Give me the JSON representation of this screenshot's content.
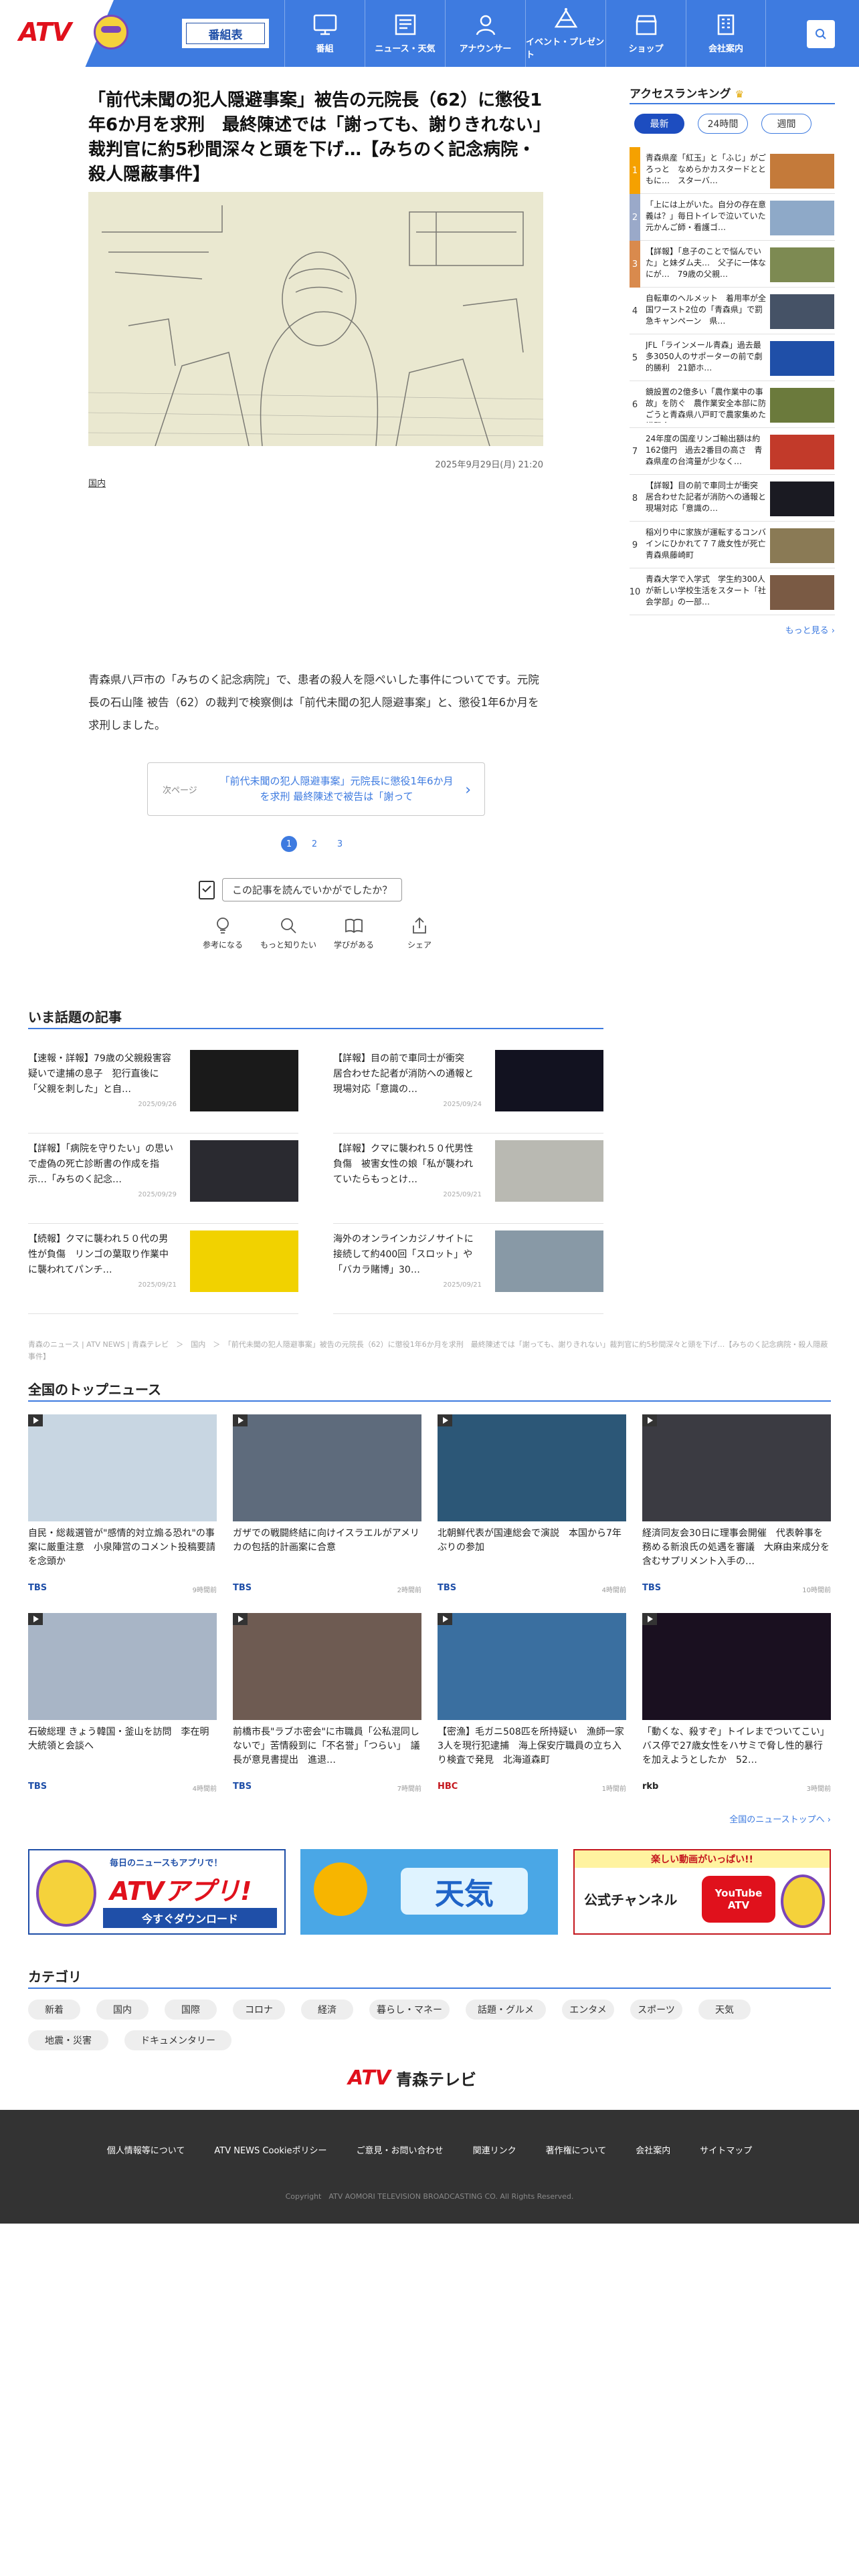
{
  "header": {
    "logo": "ATV",
    "program_button": "番組表",
    "nav": [
      {
        "label": "番組",
        "icon": "tv-icon"
      },
      {
        "label": "ニュース・天気",
        "icon": "news-icon"
      },
      {
        "label": "アナウンサー",
        "icon": "announcer-icon"
      },
      {
        "label": "イベント・プレゼント",
        "icon": "event-icon"
      },
      {
        "label": "ショップ",
        "icon": "shop-icon"
      },
      {
        "label": "会社案内",
        "icon": "company-icon"
      }
    ],
    "search_icon": "search-icon"
  },
  "article": {
    "title": "「前代未聞の犯人隠避事案」被告の元院長（62）に懲役1年6か月を求刑　最終陳述では「謝っても、謝りきれない」裁判官に約5秒間深々と頭を下げ…【みちのく記念病院・殺人隠蔽事件】",
    "date": "2025年9月29日(月) 21:20",
    "category": "国内",
    "body": "青森県八戸市の「みちのく記念病院」で、患者の殺人を隠ぺいした事件についてです。元院長の石山隆 被告（62）の裁判で検察側は「前代未聞の犯人隠避事案」と、懲役1年6か月を求刑しました。",
    "next_label": "次ページ",
    "next_title": "「前代未聞の犯人隠避事案」元院長に懲役1年6か月を求刑 最終陳述で被告は「謝って",
    "pages": [
      "1",
      "2",
      "3"
    ],
    "feedback_question": "この記事を読んでいかがでしたか？",
    "reactions": [
      "参考になる",
      "もっと知りたい",
      "学びがある",
      "シェア"
    ]
  },
  "ranking": {
    "title": "アクセスランキング",
    "tabs": [
      "最新",
      "24時間",
      "週間"
    ],
    "items": [
      {
        "rank": "1",
        "text": "青森県産「紅玉」と「ふじ」がごろっと　なめらかカスタードとともに…　スターバ…",
        "thumb": "#c47a3a"
      },
      {
        "rank": "2",
        "text": "「上には上がいた。自分の存在意義は？」毎日トイレで泣いていた元かんご師・看護ゴ…",
        "thumb": "#8ea9c8"
      },
      {
        "rank": "3",
        "text": "【詳報】「息子のことで悩んでいた」と妹ダム夫…　父子に一体なにが…　79歳の父親…",
        "thumb": "#7d8a52"
      },
      {
        "rank": "4",
        "text": "自転車のヘルメット　着用率が全国ワースト2位の「青森県」で罰急キャンペーン　県…",
        "thumb": "#455266"
      },
      {
        "rank": "5",
        "text": "JFL「ラインメール青森」過去最多3050人のサポーターの前で劇的勝利　21節ホ…",
        "thumb": "#1f4fa8"
      },
      {
        "rank": "6",
        "text": "鏡設置の2億多い「農作業中の事故」を防ぐ　農作業安全本部に防ごうと青森県八戸町で農家集めた講習会…",
        "thumb": "#6b7a3c"
      },
      {
        "rank": "7",
        "text": "24年度の国産リンゴ輸出額は約162億円　過去2番目の高さ　青森県産の台湾量が少なく…",
        "thumb": "#c23a2a"
      },
      {
        "rank": "8",
        "text": "【詳報】目の前で車同士が衝突　居合わせた記者が消防への通報と現場対応「意識の…",
        "thumb": "#1a1a22"
      },
      {
        "rank": "9",
        "text": "稲刈り中に家族が運転するコンバインにひかれて７７歳女性が死亡　青森県藤崎町",
        "thumb": "#8a7a55"
      },
      {
        "rank": "10",
        "text": "青森大学で入学式　学生約300人が新しい学校生活をスタート「社会学部」の一部…",
        "thumb": "#7a5a44"
      }
    ],
    "more": "もっと見る"
  },
  "trending": {
    "title": "いま話題の記事",
    "items": [
      {
        "text": "【速報・詳報】79歳の父親殺害容疑いで逮捕の息子　犯行直後に「父親を刺した」と自…",
        "date": "2025/09/26",
        "thumb": "#1a1a1a"
      },
      {
        "text": "【詳報】目の前で車同士が衝突　居合わせた記者が消防への通報と現場対応「意識の…",
        "date": "2025/09/24",
        "thumb": "#121220"
      },
      {
        "text": "【詳報】「病院を守りたい」の思いで虚偽の死亡診断書の作成を指示…「みちのく記念…",
        "date": "2025/09/29",
        "thumb": "#2a2a30"
      },
      {
        "text": "【詳報】クマに襲われ５０代男性負傷　被害女性の娘「私が襲われていたらもっとけ…",
        "date": "2025/09/21",
        "thumb": "#b9b9b2"
      },
      {
        "text": "【続報】クマに襲われ５０代の男性が負傷　リンゴの葉取り作業中に襲われてパンチ…",
        "date": "2025/09/21",
        "thumb": "#f1d200"
      },
      {
        "text": "海外のオンラインカジノサイトに接続して約400回「スロット」や「バカラ賭博」30…",
        "date": "2025/09/21",
        "thumb": "#8899a6"
      }
    ]
  },
  "breadcrumb": "青森のニュース | ATV NEWS | 青森テレビ　＞　国内　＞　「前代未聞の犯人隠避事案」被告の元院長（62）に懲役1年6か月を求刑　最終陳述では「謝っても、謝りきれない」裁判官に約5秒間深々と頭を下げ…【みちのく記念病院・殺人隠蔽事件】",
  "top_news": {
    "title": "全国のトップニュース",
    "items": [
      {
        "title": "自民・総裁選管が\"感情的対立煽る恐れ\"の事案に厳重注意　小泉陣営のコメント投稿要請を念頭か",
        "source": "TBS",
        "time": "9時間前",
        "src_color": "#1f4fa8",
        "thumb": "#c8d6e2"
      },
      {
        "title": "ガザでの戦闘終結に向けイスラエルがアメリカの包括的計画案に合意",
        "source": "TBS",
        "time": "2時間前",
        "src_color": "#1f4fa8",
        "thumb": "#5e6b7c"
      },
      {
        "title": "北朝鮮代表が国連総会で演説　本国から7年ぶりの参加",
        "source": "TBS",
        "time": "4時間前",
        "src_color": "#1f4fa8",
        "thumb": "#2c5777"
      },
      {
        "title": "経済同友会30日に理事会開催　代表幹事を務める新浪氏の処遇を審議　大麻由来成分を含むサプリメント入手の…",
        "source": "TBS",
        "time": "10時間前",
        "src_color": "#1f4fa8",
        "thumb": "#3b3b42"
      },
      {
        "title": "石破総理 きょう韓国・釜山を訪問　李在明大統領と会談へ",
        "source": "TBS",
        "time": "4時間前",
        "src_color": "#1f4fa8",
        "thumb": "#a8b5c6"
      },
      {
        "title": "前橋市長\"ラブホ密会\"に市職員「公私混同しないで」苦情殺到に「不名誉」「つらい」　議長が意見書提出　進退…",
        "source": "TBS",
        "time": "7時間前",
        "src_color": "#1f4fa8",
        "thumb": "#6e5b52"
      },
      {
        "title": "【密漁】毛ガニ508匹を所持疑い　漁師一家3人を現行犯逮捕　海上保安庁職員の立ち入り検査で発見　北海道森町",
        "source": "HBC",
        "time": "1時間前",
        "src_color": "#c4171e",
        "thumb": "#3a6fa0"
      },
      {
        "title": "「動くな、殺すぞ」トイレまでついてこい」バス停で27歳女性をハサミで脅し性的暴行を加えようとしたか　52…",
        "source": "rkb",
        "time": "3時間前",
        "src_color": "#222222",
        "thumb": "#1a1020"
      }
    ],
    "all_link": "全国のニューストップへ"
  },
  "banners": [
    {
      "top": "毎日のニュースもアプリで！",
      "main": "ATVアプリ!",
      "sub": "今すぐダウンロード"
    },
    {
      "main": "天気"
    },
    {
      "top": "楽しい動画がいっぱい!!",
      "main": "公式チャンネル",
      "sub": "YouTube ATV"
    }
  ],
  "categories": {
    "title": "カテゴリ",
    "items": [
      "新着",
      "国内",
      "国際",
      "コロナ",
      "経済",
      "暮らし・マネー",
      "話題・グルメ",
      "エンタメ",
      "スポーツ",
      "天気",
      "地震・災害",
      "ドキュメンタリー"
    ]
  },
  "footer": {
    "logo_atv": "ATV",
    "logo_name": "青森テレビ",
    "links": [
      "個人情報等について",
      "ATV NEWS Cookieポリシー",
      "ご意見・お問い合わせ",
      "関連リンク",
      "著作権について",
      "会社案内",
      "サイトマップ"
    ],
    "copyright": "Copyright　ATV AOMORI TELEVISION BROADCASTING CO. All Rights Reserved."
  }
}
